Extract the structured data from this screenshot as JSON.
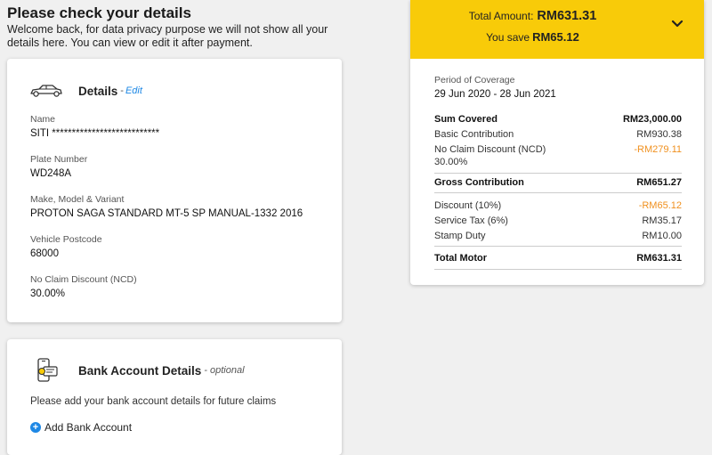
{
  "page": {
    "title": "Please check your details",
    "intro": "Welcome back, for data privacy purpose we will not show all your details here. You can view or edit it after payment."
  },
  "details": {
    "title": "Details",
    "separator": "-",
    "edit_label": "Edit",
    "icon": "car-icon",
    "fields": [
      {
        "label": "Name",
        "value": "SITI ***************************"
      },
      {
        "label": "Plate Number",
        "value": "WD248A"
      },
      {
        "label": "Make, Model & Variant",
        "value": "PROTON SAGA STANDARD MT-5 SP MANUAL-1332 2016"
      },
      {
        "label": "Vehicle Postcode",
        "value": "68000"
      },
      {
        "label": "No Claim Discount (NCD)",
        "value": "30.00%"
      }
    ]
  },
  "bank": {
    "title": "Bank Account Details",
    "optional_label": "- optional",
    "icon": "phone-card-icon",
    "description": "Please add your bank account details for future claims",
    "add_label": "Add Bank Account"
  },
  "summary": {
    "total_label": "Total Amount:",
    "total_amount": "RM631.31",
    "save_label": "You save",
    "save_amount": "RM65.12",
    "accent_color": "#f8cb09",
    "period_label": "Period of Coverage",
    "period_value": "29 Jun 2020 - 28 Jun 2021",
    "sum_covered_label": "Sum Covered",
    "sum_covered_value": "RM23,000.00",
    "basic_label": "Basic Contribution",
    "basic_value": "RM930.38",
    "ncd_label": "No Claim Discount (NCD)",
    "ncd_value": "-RM279.11",
    "ncd_percent": "30.00%",
    "gross_label": "Gross Contribution",
    "gross_value": "RM651.27",
    "discount_label": "Discount (10%)",
    "discount_value": "-RM65.12",
    "tax_label": "Service Tax (6%)",
    "tax_value": "RM35.17",
    "stamp_label": "Stamp Duty",
    "stamp_value": "RM10.00",
    "total_motor_label": "Total Motor",
    "total_motor_value": "RM631.31"
  }
}
